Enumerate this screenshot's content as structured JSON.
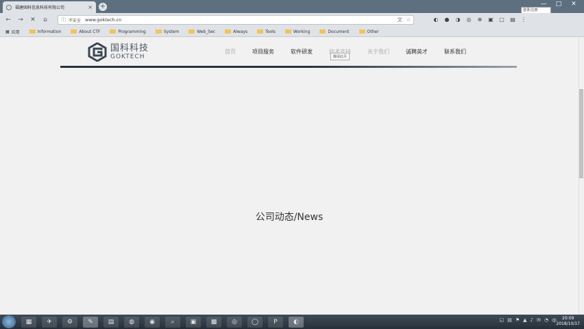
{
  "browser": {
    "tab_title": "福建国科信息科技有限公司",
    "new_tab_label": "+",
    "window_controls": {
      "minimize": "—",
      "maximize": "□",
      "close": "✕"
    },
    "user_chip": "登录/注册"
  },
  "toolbar": {
    "back": "←",
    "forward": "→",
    "reload": "✕",
    "home": "⌂",
    "insecure_label": "不安全",
    "url": "www.goktech.cn",
    "translate": "文",
    "bookmark_star": "☆",
    "extensions": [
      "◐",
      "●",
      "◑",
      "◎",
      "⊕",
      "▣",
      "▢",
      "▤",
      "⋮"
    ]
  },
  "bookmarks": [
    "应用",
    "Information",
    "About CTF",
    "Programming",
    "System",
    "Web_Sec",
    "Always",
    "Tools",
    "Working",
    "Document",
    "Other"
  ],
  "site": {
    "logo_cn": "国科科技",
    "logo_en": "GOKTECH",
    "nav": [
      "首页",
      "项目服务",
      "软件研发",
      "技术支持",
      "关于我们",
      "诚聘英才",
      "联系我们"
    ],
    "tooltip": "翻译此页",
    "news_title": "公司动态/News"
  },
  "taskbar": {
    "apps": [
      "▦",
      "✈",
      "⚙",
      "✎",
      "▤",
      "◍",
      "◉",
      "⌕",
      "▣",
      "▩",
      "◎",
      "◯",
      "P",
      "◐"
    ],
    "tray": [
      "◱",
      "▤",
      "⚑",
      "▲",
      "♪",
      "✉",
      "◔",
      "中"
    ],
    "time": "20:09",
    "date": "2018/10/17"
  }
}
